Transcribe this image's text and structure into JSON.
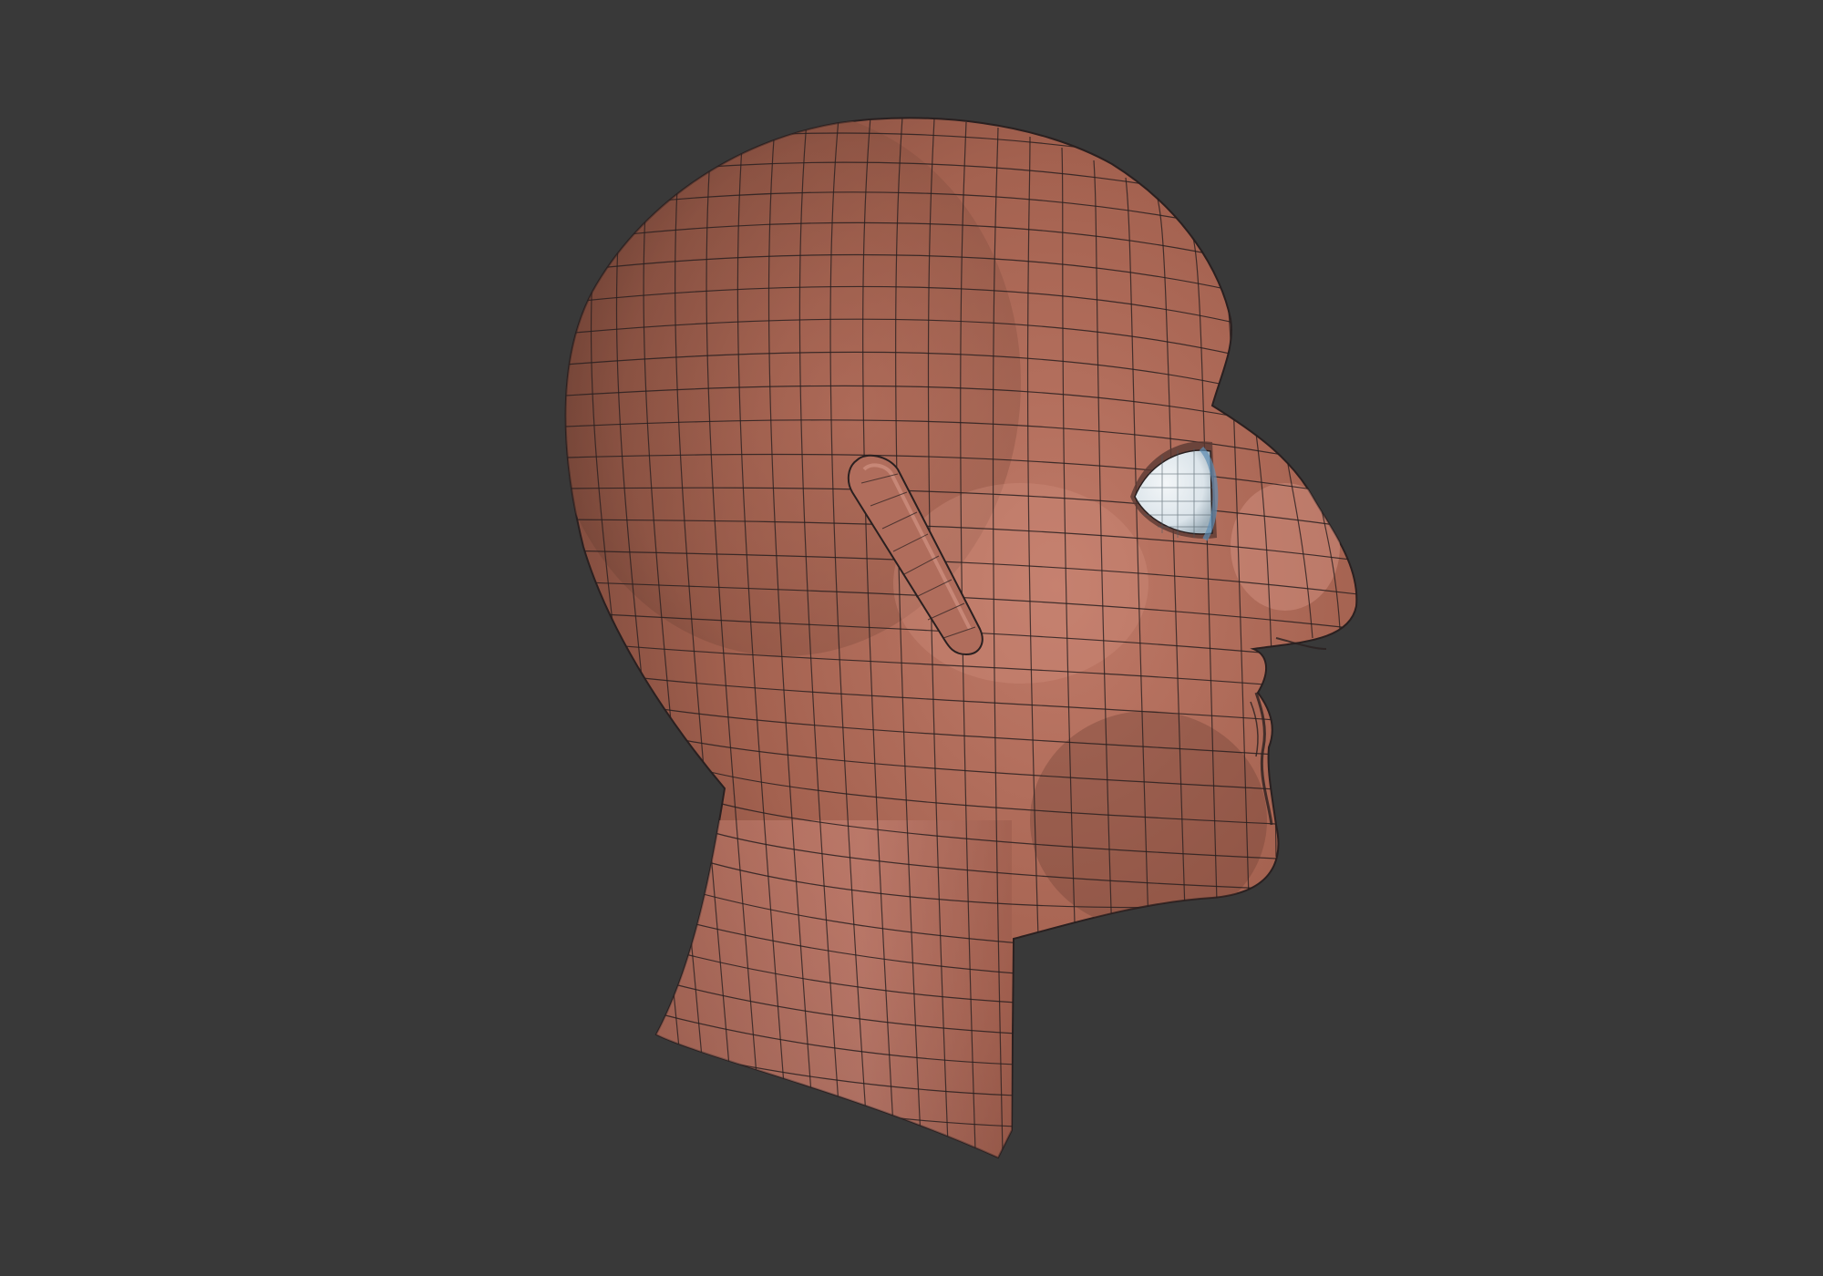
{
  "viewport": {
    "background_color": "#393939",
    "model": {
      "kind": "head-wireframe-model",
      "skin_color": "#b9705f",
      "skin_shadow_color": "#6f4236",
      "eye_color": "#dde7ee",
      "wire_color": "#2a2020"
    }
  }
}
